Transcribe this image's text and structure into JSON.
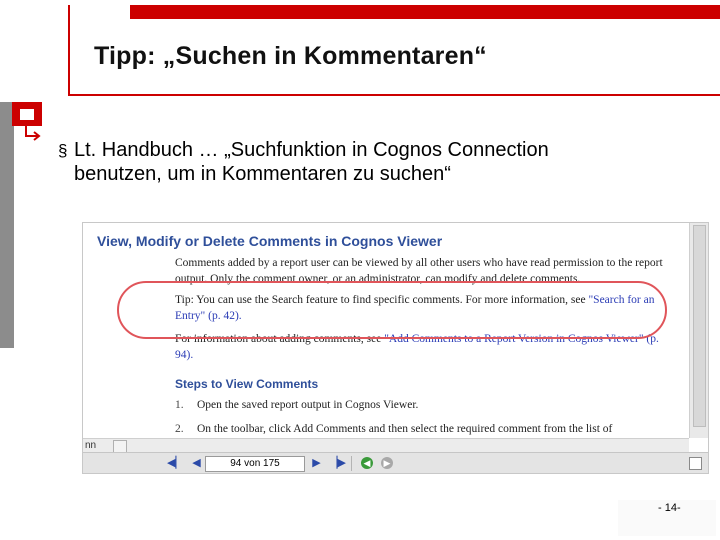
{
  "slide": {
    "title": "Tipp: „Suchen in Kommentaren“",
    "bullet_marker": "§",
    "bullet_text": "Lt. Handbuch … „Suchfunktion in Cognos Connection benutzen, um in Kommentaren zu suchen“",
    "page_number": "- 14-",
    "colors": {
      "accent": "#cc0000",
      "gray_bar": "#8c8c8c"
    }
  },
  "viewer": {
    "heading": "View, Modify or Delete Comments in Cognos Viewer",
    "p1": "Comments added by a report user can be viewed by all other users who have read permission to the report output. Only the comment owner, or an administrator, can modify and delete comments.",
    "p2_prefix": "Tip: You can use the Search feature to find specific comments. For more information, see ",
    "p2_link": "\"Search for an Entry\" (p. 42).",
    "p3_prefix": "For information about adding comments, see ",
    "p3_link": "\"Add Comments to a Report Version in Cognos Viewer\" (p. 94).",
    "subheading": "Steps to View Comments",
    "steps": [
      {
        "num": "1.",
        "text": "Open the saved report output in Cognos Viewer."
      },
      {
        "num": "2.",
        "text": "On the toolbar, click Add Comments and then select the required comment from the list of"
      }
    ],
    "hscroll_label": "nn",
    "page_field_value": "94 von 175",
    "icons": {
      "first": "first-page-icon",
      "prev": "previous-page-icon",
      "next": "next-page-icon",
      "last": "last-page-icon",
      "back": "back-icon",
      "forward": "forward-icon"
    },
    "colors": {
      "heading": "#2f4f9a",
      "link": "#2a3bb5",
      "highlight": "#e0555a"
    }
  }
}
